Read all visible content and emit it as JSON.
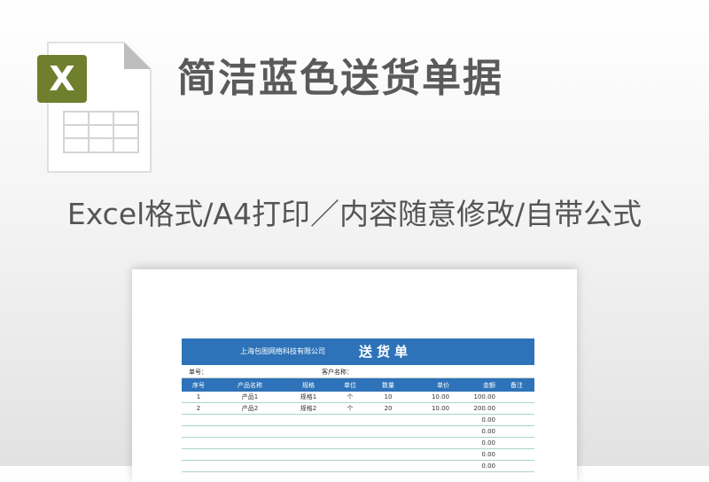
{
  "title": "简洁蓝色送货单据",
  "subtitle": "Excel格式/A4打印／内容随意修改/自带公式",
  "icon": {
    "name": "excel-file-icon",
    "badge": "X",
    "badge_color": "#6f7f2e",
    "page_color": "#ffffff",
    "fold_color": "#bdbdbd"
  },
  "sheet": {
    "company": "上海包图网络科技有限公司",
    "doc_title": "送货单",
    "order_no_label": "单号：",
    "customer_label": "客户名称：",
    "header_color": "#2e73b9",
    "columns": [
      "序号",
      "产品名称",
      "规格",
      "单位",
      "数量",
      "单价",
      "金额",
      "备注"
    ],
    "rows": [
      [
        "1",
        "产品1",
        "规格1",
        "个",
        "10",
        "10.00",
        "100.00",
        ""
      ],
      [
        "2",
        "产品2",
        "规格2",
        "个",
        "20",
        "10.00",
        "200.00",
        ""
      ],
      [
        "",
        "",
        "",
        "",
        "",
        "",
        "0.00",
        ""
      ],
      [
        "",
        "",
        "",
        "",
        "",
        "",
        "0.00",
        ""
      ],
      [
        "",
        "",
        "",
        "",
        "",
        "",
        "0.00",
        ""
      ],
      [
        "",
        "",
        "",
        "",
        "",
        "",
        "0.00",
        ""
      ],
      [
        "",
        "",
        "",
        "",
        "",
        "",
        "0.00",
        ""
      ]
    ]
  }
}
